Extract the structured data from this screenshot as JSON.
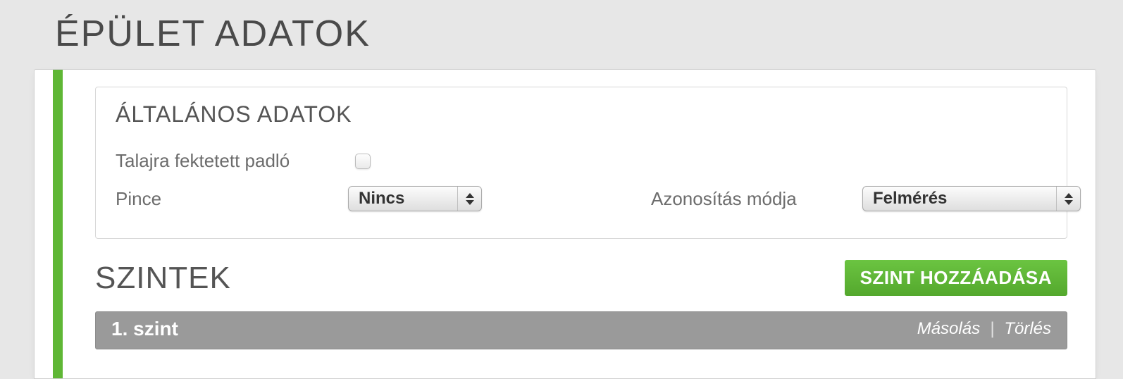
{
  "page_title": "ÉPÜLET ADATOK",
  "general": {
    "title": "ÁLTALÁNOS ADATOK",
    "ground_floor_label": "Talajra fektetett padló",
    "cellar_label": "Pince",
    "cellar_value": "Nincs",
    "identification_label": "Azonosítás módja",
    "identification_value": "Felmérés"
  },
  "levels": {
    "title": "SZINTEK",
    "add_button": "SZINT HOZZÁADÁSA",
    "items": [
      {
        "name": "1. szint",
        "copy_label": "Másolás",
        "delete_label": "Törlés"
      }
    ]
  },
  "separator": "|"
}
